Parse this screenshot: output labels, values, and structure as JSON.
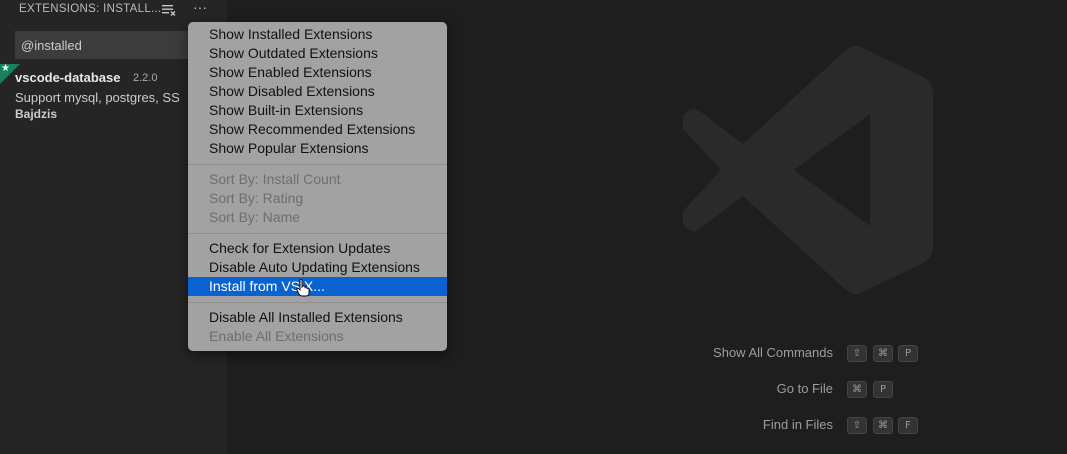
{
  "sidebar": {
    "title": "EXTENSIONS: INSTALL...",
    "clear_icon": "clear-all-icon",
    "more_icon": "ellipsis-icon",
    "more_glyph": "···",
    "search": {
      "value": "@installed",
      "placeholder": ""
    },
    "extension": {
      "name": "vscode-database",
      "version": "2.2.0",
      "description": "Support mysql, postgres, SS",
      "author": "Bajdzis",
      "badge_icon": "star-icon",
      "badge_glyph": "★",
      "badge_color": "#16825d"
    }
  },
  "menu": {
    "group1": [
      "Show Installed Extensions",
      "Show Outdated Extensions",
      "Show Enabled Extensions",
      "Show Disabled Extensions",
      "Show Built-in Extensions",
      "Show Recommended Extensions",
      "Show Popular Extensions"
    ],
    "group2": [
      "Sort By: Install Count",
      "Sort By: Rating",
      "Sort By: Name"
    ],
    "group3": [
      "Check for Extension Updates",
      "Disable Auto Updating Extensions",
      "Install from VSIX..."
    ],
    "group4": [
      "Disable All Installed Extensions",
      "Enable All Extensions"
    ],
    "selected_item": "Install from VSIX...",
    "selected_color": "#0a62d0"
  },
  "watermark": {
    "logo_icon": "vscode-logo-icon",
    "shortcuts": [
      {
        "label": "Show All Commands",
        "keys": [
          "⇧",
          "⌘",
          "P"
        ]
      },
      {
        "label": "Go to File",
        "keys": [
          "⌘",
          "P"
        ]
      },
      {
        "label": "Find in Files",
        "keys": [
          "⇧",
          "⌘",
          "F"
        ]
      }
    ]
  }
}
